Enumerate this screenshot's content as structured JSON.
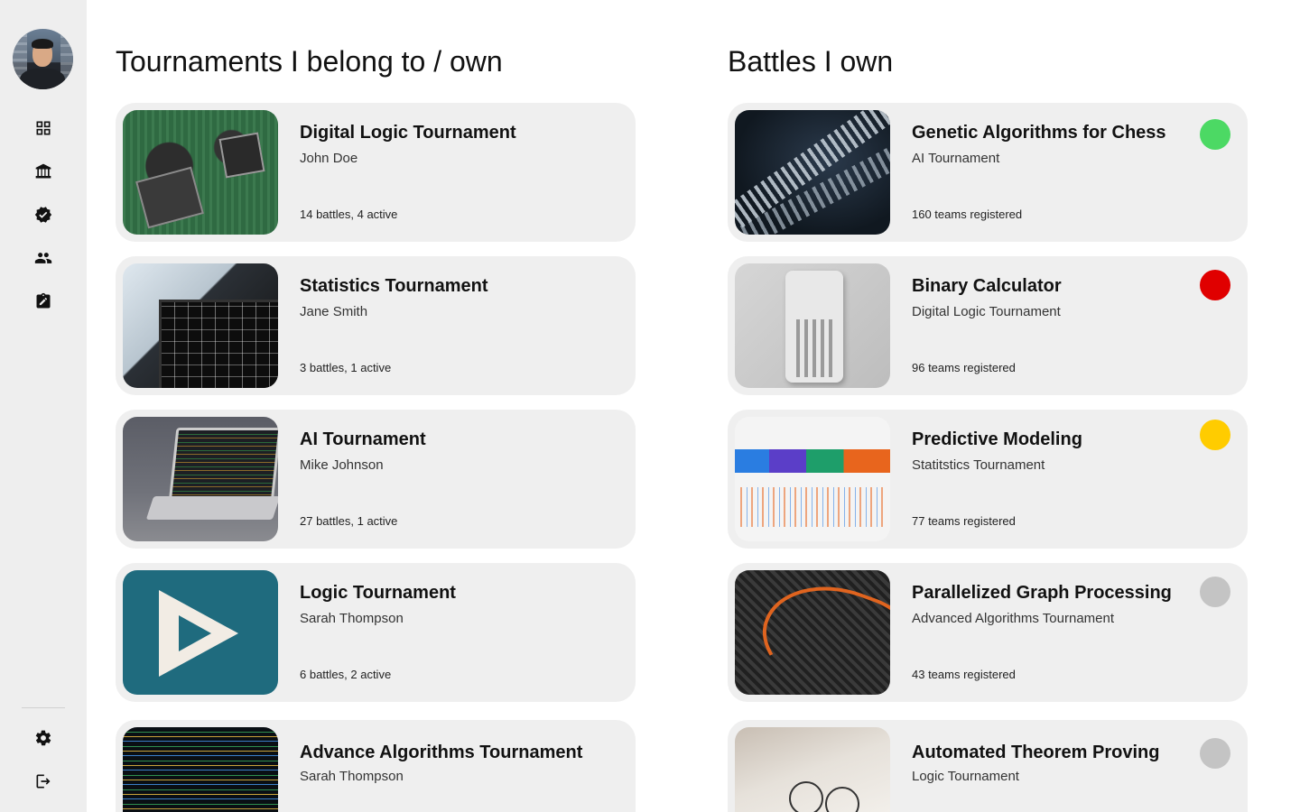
{
  "sidebar": {
    "nav": [
      {
        "icon": "dashboard-icon"
      },
      {
        "icon": "school-icon"
      },
      {
        "icon": "verified-icon"
      },
      {
        "icon": "people-icon"
      },
      {
        "icon": "assignment-icon"
      }
    ],
    "bottom": [
      {
        "icon": "gear-icon"
      },
      {
        "icon": "logout-icon"
      }
    ]
  },
  "tournaments": {
    "heading": "Tournaments I belong to / own",
    "items": [
      {
        "title": "Digital Logic Tournament",
        "owner": "John Doe",
        "meta": "14 battles, 4 active",
        "image": "circuit-board"
      },
      {
        "title": "Statistics Tournament",
        "owner": "Jane Smith",
        "meta": "3 battles, 1 active",
        "image": "laptop-chart"
      },
      {
        "title": "AI Tournament",
        "owner": "Mike Johnson",
        "meta": "27 battles, 1 active",
        "image": "laptop-code"
      },
      {
        "title": "Logic Tournament",
        "owner": "Sarah Thompson",
        "meta": "6 battles, 2 active",
        "image": "impossible-triangle"
      },
      {
        "title": "Advance Algorithms Tournament",
        "owner": "Sarah Thompson",
        "meta": "",
        "image": "code-screen"
      }
    ]
  },
  "battles": {
    "heading": "Battles I own",
    "items": [
      {
        "title": "Genetic Algorithms for Chess",
        "tournament": "AI Tournament",
        "meta": "160 teams registered",
        "status_color": "#4cd964",
        "image": "dna-helix"
      },
      {
        "title": "Binary Calculator",
        "tournament": "Digital Logic Tournament",
        "meta": "96 teams registered",
        "status_color": "#e00000",
        "image": "calculator"
      },
      {
        "title": "Predictive Modeling",
        "tournament": "Statitstics Tournament",
        "meta": "77 teams registered",
        "status_color": "#ffcc00",
        "image": "analytics-dashboard"
      },
      {
        "title": "Parallelized Graph Processing",
        "tournament": "Advanced Algorithms Tournament",
        "meta": "43 teams registered",
        "status_color": "#c4c4c4",
        "image": "3d-surface"
      },
      {
        "title": "Automated Theorem Proving",
        "tournament": "Logic Tournament",
        "meta": "",
        "status_color": "#c4c4c4",
        "image": "glasses-papers"
      }
    ]
  }
}
